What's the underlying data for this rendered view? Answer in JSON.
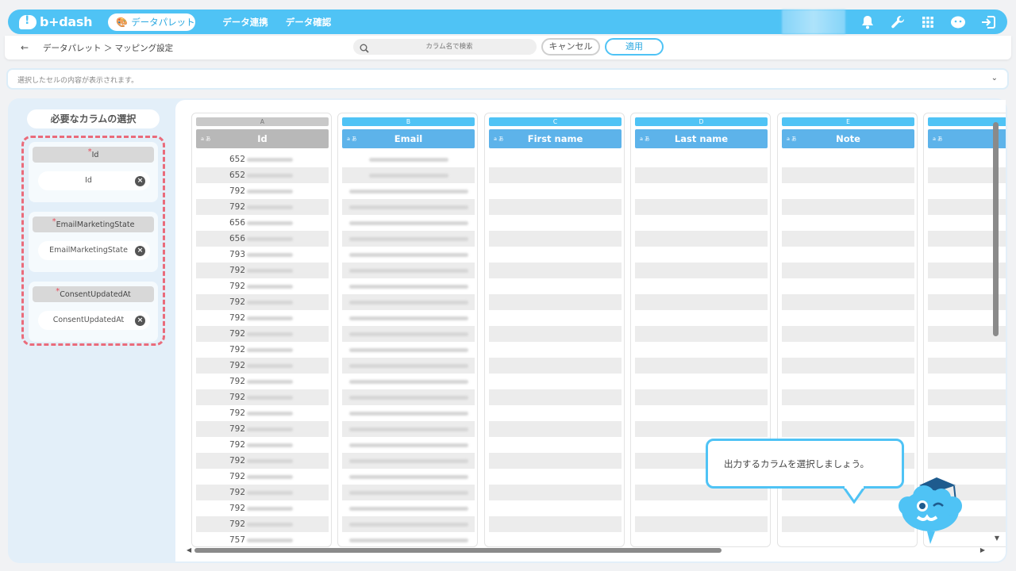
{
  "header": {
    "logo": "b+dash",
    "palette_button": "データパレット",
    "nav": [
      "データ連携",
      "データ確認"
    ]
  },
  "subbar": {
    "breadcrumb": "データパレット ＞ マッピング設定",
    "search_placeholder": "カラム名で検索",
    "cancel": "キャンセル",
    "apply": "適用"
  },
  "cell_display": "選択したセルの内容が表示されます。",
  "left_panel": {
    "title": "必要なカラムの選択",
    "groups": [
      {
        "label": "Id",
        "value": "Id"
      },
      {
        "label": "EmailMarketingState",
        "value": "EmailMarketingState"
      },
      {
        "label": "ConsentUpdatedAt",
        "value": "ConsentUpdatedAt"
      }
    ]
  },
  "columns": [
    {
      "letter": "A",
      "name": "Id",
      "type": "a あ"
    },
    {
      "letter": "B",
      "name": "Email",
      "type": "a あ"
    },
    {
      "letter": "C",
      "name": "First name",
      "type": "a あ"
    },
    {
      "letter": "D",
      "name": "Last name",
      "type": "a あ"
    },
    {
      "letter": "E",
      "name": "Note",
      "type": "a あ"
    },
    {
      "letter": "",
      "name": "",
      "type": "a あ"
    }
  ],
  "id_values": [
    "652",
    "652",
    "792",
    "792",
    "656",
    "656",
    "793",
    "792",
    "792",
    "792",
    "792",
    "792",
    "792",
    "792",
    "792",
    "792",
    "792",
    "792",
    "792",
    "792",
    "792",
    "792",
    "792",
    "792",
    "757"
  ],
  "tooltip": "出力するカラムを選択しましょう。",
  "colors": {
    "accent": "#4fc3f5",
    "highlight": "#ea6b7b",
    "selected_header": "#b8b8b8"
  }
}
